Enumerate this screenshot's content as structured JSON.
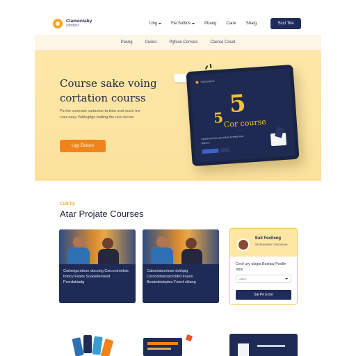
{
  "header": {
    "logo_line1": "Clamontaby",
    "logo_line2": "sofrdiers",
    "nav": [
      {
        "label": "Ubg",
        "dropdown": true
      },
      {
        "label": "Fie Sotlins",
        "dropdown": true
      },
      {
        "label": "Pbang",
        "dropdown": false
      },
      {
        "label": "Cane",
        "dropdown": false
      },
      {
        "label": "Sbaig",
        "dropdown": false
      }
    ],
    "cta_label": "Sccl Tire"
  },
  "subnav": [
    "Pasng",
    "Cuiles",
    "Pgfsce Corrses",
    "Casrse Cosct"
  ],
  "hero": {
    "title": "Course sake voing cortation courss",
    "description": "Pa the conerate cartactoe ta tinto scrit sccin tne cuer oaey Vattingtige batting the ucs oscres",
    "button_label": "Ugy Eluksin",
    "tablet": {
      "top_text": "Garnetteca",
      "big_number": "5",
      "small_number": "5",
      "course_word": "Cor course",
      "lines": "Caoser tincher ssce ticleis Ecerbat tovn dolnccs"
    }
  },
  "section": {
    "eyebrow": "Cutt lty",
    "title": "Atar Projate Courses"
  },
  "cards": [
    {
      "text": "Corbeigcretose doccing Csrconiroelsis fotocy Fsaxs Scaoeileroesd Pscrdakiadg"
    },
    {
      "text": "Caboeiaicretose dothpig Csrconiroeniscrcidrd Fsaxs Bealedsideptes Fsord cklang"
    }
  ],
  "sidebar_card": {
    "name": "Eail Feolleng",
    "subtitle": "Scrteaostee cosicieoue",
    "text": "Ceof ury ulsgis Bsstiay Poslle fdos",
    "input_placeholder": "ABcs",
    "button_label": "Sal Pe Ecne"
  },
  "colors": {
    "accent": "#f0841b",
    "navy": "#1f2b5c",
    "hero_bg": "#fde8a8"
  }
}
